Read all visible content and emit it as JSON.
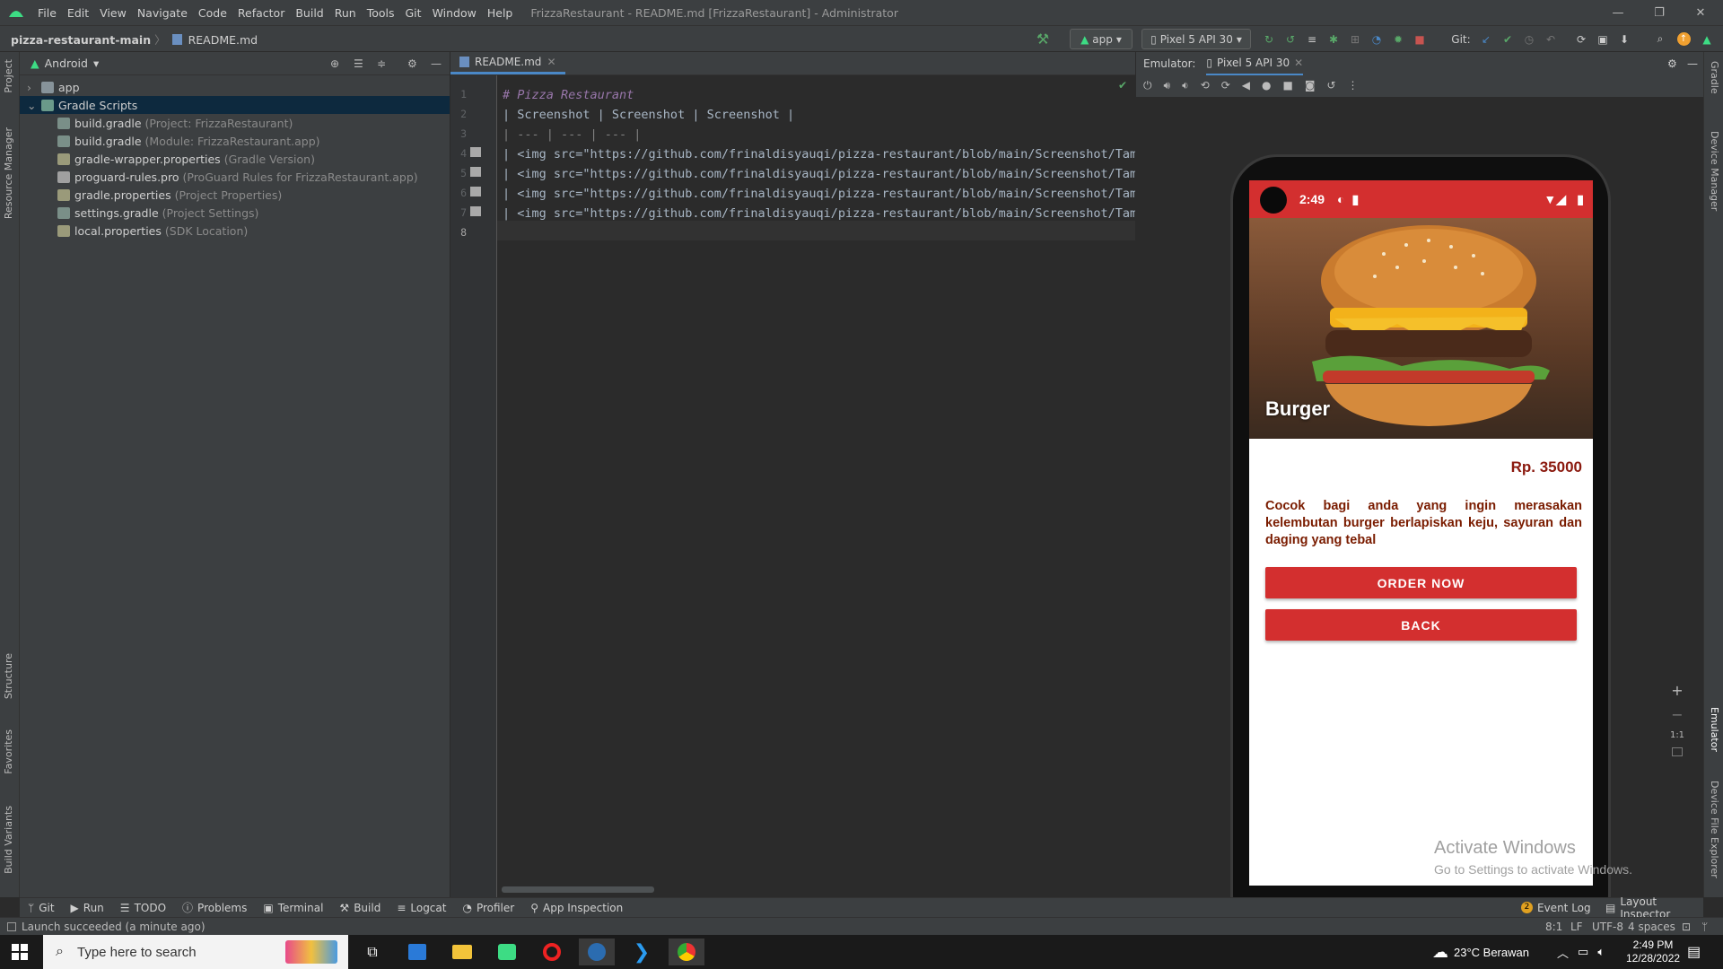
{
  "menubar": {
    "items": [
      "File",
      "Edit",
      "View",
      "Navigate",
      "Code",
      "Refactor",
      "Build",
      "Run",
      "Tools",
      "Git",
      "Window",
      "Help"
    ],
    "title": "FrizzaRestaurant - README.md [FrizzaRestaurant] - Administrator"
  },
  "navbar": {
    "project": "pizza-restaurant-main",
    "file": "README.md",
    "run_config": "app",
    "device": "Pixel 5 API 30",
    "git_label": "Git:"
  },
  "left_tabs": [
    "Project",
    "Resource Manager",
    "Structure",
    "Favorites",
    "Build Variants"
  ],
  "right_tabs": [
    "Gradle",
    "Device Manager",
    "Emulator",
    "Device File Explorer"
  ],
  "project": {
    "view": "Android",
    "tree": [
      {
        "label": "app",
        "hint": ""
      },
      {
        "label": "Gradle Scripts",
        "hint": ""
      },
      {
        "label": "build.gradle",
        "hint": "(Project: FrizzaRestaurant)"
      },
      {
        "label": "build.gradle",
        "hint": "(Module: FrizzaRestaurant.app)"
      },
      {
        "label": "gradle-wrapper.properties",
        "hint": "(Gradle Version)"
      },
      {
        "label": "proguard-rules.pro",
        "hint": "(ProGuard Rules for FrizzaRestaurant.app)"
      },
      {
        "label": "gradle.properties",
        "hint": "(Project Properties)"
      },
      {
        "label": "settings.gradle",
        "hint": "(Project Settings)"
      },
      {
        "label": "local.properties",
        "hint": "(SDK Location)"
      }
    ]
  },
  "editor": {
    "tab": "README.md",
    "lines": [
      {
        "n": "1",
        "text": "# Pizza Restaurant"
      },
      {
        "n": "2",
        "text": "| Screenshot | Screenshot | Screenshot |"
      },
      {
        "n": "3",
        "text": "| --- | --- | --- |"
      },
      {
        "n": "4",
        "text": "| <img src=\"https://github.com/frinaldisyauqi/pizza-restaurant/blob/main/Screenshot/Tamp:"
      },
      {
        "n": "5",
        "text": "| <img src=\"https://github.com/frinaldisyauqi/pizza-restaurant/blob/main/Screenshot/Tamp:"
      },
      {
        "n": "6",
        "text": "| <img src=\"https://github.com/frinaldisyauqi/pizza-restaurant/blob/main/Screenshot/Tamp:"
      },
      {
        "n": "7",
        "text": "| <img src=\"https://github.com/frinaldisyauqi/pizza-restaurant/blob/main/Screenshot/Tamp:"
      },
      {
        "n": "8",
        "text": ""
      }
    ]
  },
  "emulator": {
    "label": "Emulator:",
    "tab": "Pixel 5 API 30",
    "zoom_label": "1:1"
  },
  "phone": {
    "time": "2:49",
    "hero_title": "Burger",
    "price": "Rp. 35000",
    "description": "Cocok bagi anda yang ingin merasakan kelembutan burger berlapiskan keju, sayuran dan daging yang tebal",
    "order_button": "ORDER NOW",
    "back_button": "BACK"
  },
  "watermark": {
    "title": "Activate Windows",
    "subtitle": "Go to Settings to activate Windows."
  },
  "toolwindows": [
    "Git",
    "Run",
    "TODO",
    "Problems",
    "Terminal",
    "Build",
    "Logcat",
    "Profiler",
    "App Inspection"
  ],
  "toolwindows_right": [
    "Event Log",
    "Layout Inspector"
  ],
  "event_log_count": "2",
  "status": {
    "message": "Launch succeeded (a minute ago)",
    "position": "8:1",
    "line_sep": "LF",
    "encoding": "UTF-8",
    "indent": "4 spaces"
  },
  "taskbar": {
    "search_placeholder": "Type here to search",
    "weather": "23°C  Berawan",
    "time": "2:49 PM",
    "date": "12/28/2022"
  },
  "colors": {
    "accent": "#d32f2f",
    "ide_bg": "#2b2b2b",
    "panel_bg": "#3c3f41"
  }
}
